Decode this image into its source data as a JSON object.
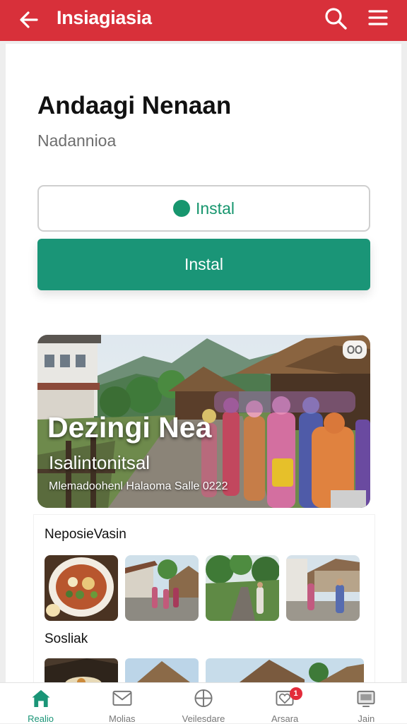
{
  "header": {
    "title": "Insiagiasia",
    "bg_color": "#d8303a",
    "back_icon": "arrow-left-icon",
    "search_icon": "search-icon",
    "menu_icon": "hamburger-menu-icon"
  },
  "app": {
    "name": "Andaagi Nenaan",
    "subtitle": "Nadannioa"
  },
  "buttons": {
    "install_outline_label": "Instal",
    "install_primary_label": "Instal",
    "accent_color": "#1a9577"
  },
  "hero": {
    "heading": "Dezingi Nea",
    "subheading": "Isalintonitsal",
    "caption": "Mlemadoohenl Halaoma Salle 0222",
    "badge_icon": "view-icon"
  },
  "sections": [
    {
      "title": "NeposieVasin",
      "thumbnails": [
        "food-bowl-photo",
        "village-houses-photo",
        "garden-path-photo",
        "street-people-photo"
      ]
    },
    {
      "title": "Sosliak",
      "thumbnails": [
        "rooftop-photo",
        "thatched-roof-photo",
        "village-roof-photo"
      ]
    }
  ],
  "bottom_nav": {
    "items": [
      {
        "label": "Realio",
        "icon": "home-icon",
        "active": true
      },
      {
        "label": "Molias",
        "icon": "mail-icon",
        "active": false
      },
      {
        "label": "Veilesdare",
        "icon": "globe-icon",
        "active": false
      },
      {
        "label": "Arsara",
        "icon": "heart-notification-icon",
        "active": false,
        "badge": "1"
      },
      {
        "label": "Jain",
        "icon": "profile-card-icon",
        "active": false
      }
    ]
  }
}
